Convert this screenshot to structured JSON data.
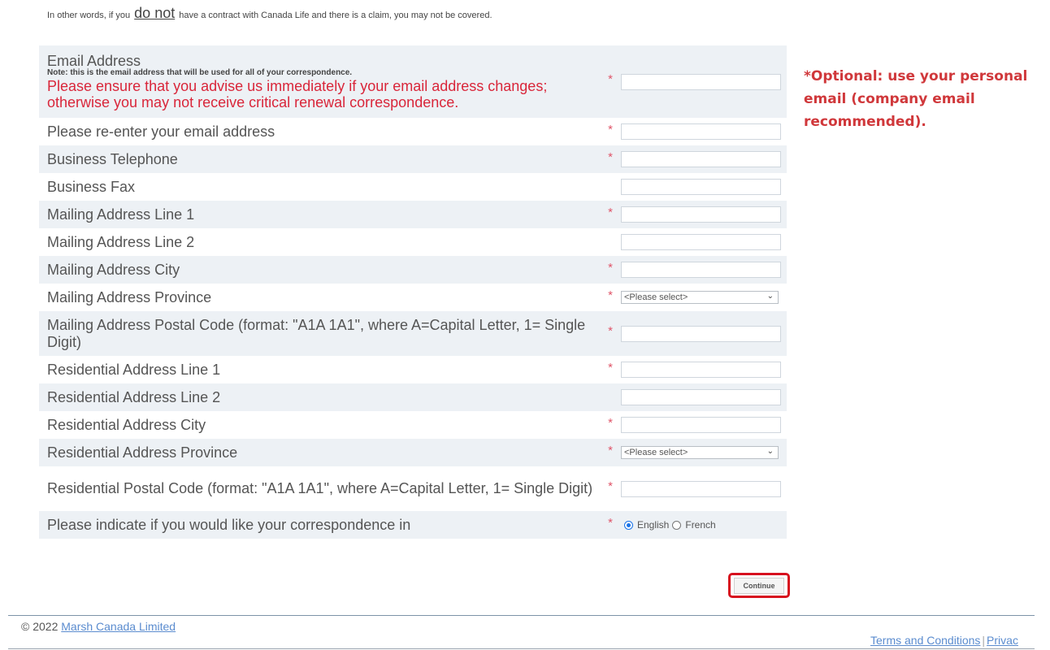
{
  "intro": {
    "prefix": "In other words, if you",
    "emphasis": "do not",
    "suffix": "have a contract with Canada Life and there is a claim, you may not be covered."
  },
  "email": {
    "label": "Email Address",
    "note": "Note: this is the email address that will be used for all of your correspondence.",
    "warning": "Please ensure that you advise us immediately if your email address changes; otherwise you may not receive critical renewal correspondence.",
    "required": true,
    "value": ""
  },
  "fields": [
    {
      "label": "Please re-enter your email address",
      "required": true,
      "type": "text",
      "value": ""
    },
    {
      "label": "Business Telephone",
      "required": true,
      "type": "text",
      "value": ""
    },
    {
      "label": "Business Fax",
      "required": false,
      "type": "text",
      "value": ""
    },
    {
      "label": "Mailing Address Line 1",
      "required": true,
      "type": "text",
      "value": ""
    },
    {
      "label": "Mailing Address Line 2",
      "required": false,
      "type": "text",
      "value": ""
    },
    {
      "label": "Mailing Address City",
      "required": true,
      "type": "text",
      "value": ""
    },
    {
      "label": "Mailing Address Province",
      "required": true,
      "type": "select",
      "value": "<Please select>"
    },
    {
      "label": "Mailing Address Postal Code (format: \"A1A 1A1\", where A=Capital Letter, 1= Single Digit)",
      "required": true,
      "type": "text",
      "value": ""
    },
    {
      "label": "Residential Address Line 1",
      "required": true,
      "type": "text",
      "value": ""
    },
    {
      "label": "Residential Address Line 2",
      "required": false,
      "type": "text",
      "value": ""
    },
    {
      "label": "Residential Address City",
      "required": true,
      "type": "text",
      "value": ""
    },
    {
      "label": "Residential Address Province",
      "required": true,
      "type": "select",
      "value": "<Please select>"
    },
    {
      "label": "Residential Postal Code (format: \"A1A 1A1\", where A=Capital Letter, 1= Single Digit)",
      "required": true,
      "type": "text",
      "value": ""
    },
    {
      "label": "Please indicate if you would like your correspondence in",
      "required": true,
      "type": "radio",
      "options": [
        "English",
        "French"
      ],
      "selected": "English"
    }
  ],
  "required_marker": "*",
  "select_chevron": "⌄",
  "annotation": "*Optional: use your personal email (company email recommended).",
  "continue_label": "Continue",
  "footer": {
    "copyright_prefix": "© 2022",
    "company_link": "Marsh Canada Limited",
    "terms_link": "Terms and Conditions",
    "separator": "|",
    "privacy_link": "Privac"
  },
  "colors": {
    "required": "#e0566a",
    "warning": "#d9263a",
    "annotation": "#d0383b",
    "highlight_box": "#d7101e",
    "row_shade": "#edf1f5",
    "link": "#5b8ccf"
  }
}
